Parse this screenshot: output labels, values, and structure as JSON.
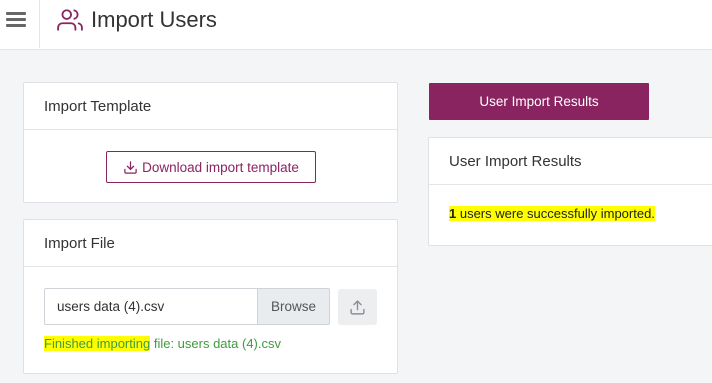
{
  "header": {
    "title": "Import Users",
    "title_icon": "users-icon",
    "menu_icon": "hamburger-menu-icon"
  },
  "import_template": {
    "title": "Import Template",
    "download_label": "Download import template",
    "download_icon": "download-icon"
  },
  "import_file": {
    "title": "Import File",
    "file_value": "users data (4).csv",
    "browse_label": "Browse",
    "upload_icon": "upload-icon",
    "status_highlight": "Finished importing",
    "status_rest": " file: users data (4).csv"
  },
  "results": {
    "button_label": "User Import Results",
    "card_title": "User Import Results",
    "count": "1",
    "message": " users were successfully imported."
  },
  "colors": {
    "brand": "#8a2461",
    "success": "#3f9b3f",
    "highlight": "#ffff00"
  }
}
